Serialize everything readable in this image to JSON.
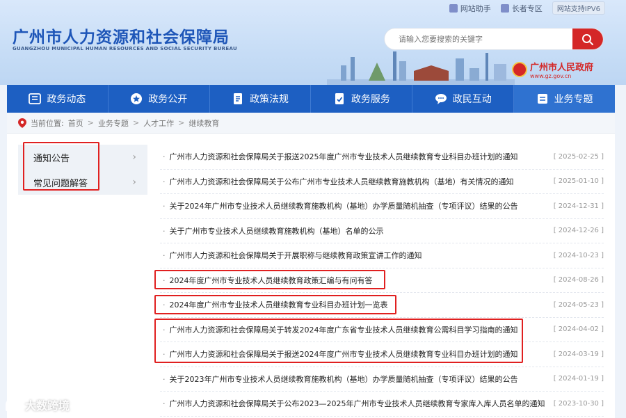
{
  "topbar": {
    "assistant_label": "网站助手",
    "elder_label": "长者专区",
    "ipv6_label": "网站支持IPV6"
  },
  "header": {
    "title_cn": "广州市人力资源和社会保障局",
    "title_en": "GUANGZHOU MUNICIPAL HUMAN RESOURCES AND SOCIAL SECURITY BUREAU",
    "search_placeholder": "请输入您要搜索的关键字",
    "gov_name": "广州市人民政府",
    "gov_url": "www.gz.gov.cn"
  },
  "nav": [
    {
      "label": "政务动态",
      "icon": "news-icon"
    },
    {
      "label": "政务公开",
      "icon": "star-icon"
    },
    {
      "label": "政策法规",
      "icon": "document-icon"
    },
    {
      "label": "政务服务",
      "icon": "service-icon"
    },
    {
      "label": "政民互动",
      "icon": "chat-icon"
    },
    {
      "label": "业务专题",
      "icon": "topic-icon"
    }
  ],
  "breadcrumb": {
    "prefix": "当前位置:",
    "items": [
      "首页",
      "业务专题",
      "人才工作",
      "继续教育"
    ]
  },
  "sidebar": {
    "items": [
      {
        "label": "通知公告"
      },
      {
        "label": "常见问题解答"
      }
    ]
  },
  "articles": [
    {
      "title": "广州市人力资源和社会保障局关于报送2025年度广州市专业技术人员继续教育专业科目办班计划的通知",
      "date": "[ 2025-02-25 ]"
    },
    {
      "title": "广州市人力资源和社会保障局关于公布广州市专业技术人员继续教育施教机构（基地）有关情况的通知",
      "date": "[ 2025-01-10 ]"
    },
    {
      "title": "关于2024年广州市专业技术人员继续教育施教机构（基地）办学质量随机抽查（专项评议）结果的公告",
      "date": "[ 2024-12-31 ]"
    },
    {
      "title": "关于广州市专业技术人员继续教育施教机构（基地）名单的公示",
      "date": "[ 2024-12-26 ]"
    },
    {
      "title": "广州市人力资源和社会保障局关于开展职称与继续教育政策宣讲工作的通知",
      "date": "[ 2024-10-23 ]"
    },
    {
      "title": "2024年度广州市专业技术人员继续教育政策汇编与有问有答",
      "date": "[ 2024-08-26 ]"
    },
    {
      "title": "2024年度广州市专业技术人员继续教育专业科目办班计划一览表",
      "date": "[ 2024-05-23 ]"
    },
    {
      "title": "广州市人力资源和社会保障局关于转发2024年度广东省专业技术人员继续教育公需科目学习指南的通知",
      "date": "[ 2024-04-02 ]"
    },
    {
      "title": "广州市人力资源和社会保障局关于报送2024年度广州市专业技术人员继续教育专业科目办班计划的通知",
      "date": "[ 2024-03-19 ]"
    },
    {
      "title": "关于2023年广州市专业技术人员继续教育施教机构（基地）办学质量随机抽查（专项评议）结果的公告",
      "date": "[ 2024-01-19 ]"
    },
    {
      "title": "广州市人力资源和社会保障局关于公布2023—2025年广州市专业技术人员继续教育专家库入库人员名单的通知",
      "date": "[ 2023-10-30 ]"
    }
  ],
  "watermark": {
    "text": "大数跨境"
  },
  "colors": {
    "nav_blue": "#1d5fc2",
    "accent_red": "#d42727",
    "highlight_red": "#e02020"
  }
}
